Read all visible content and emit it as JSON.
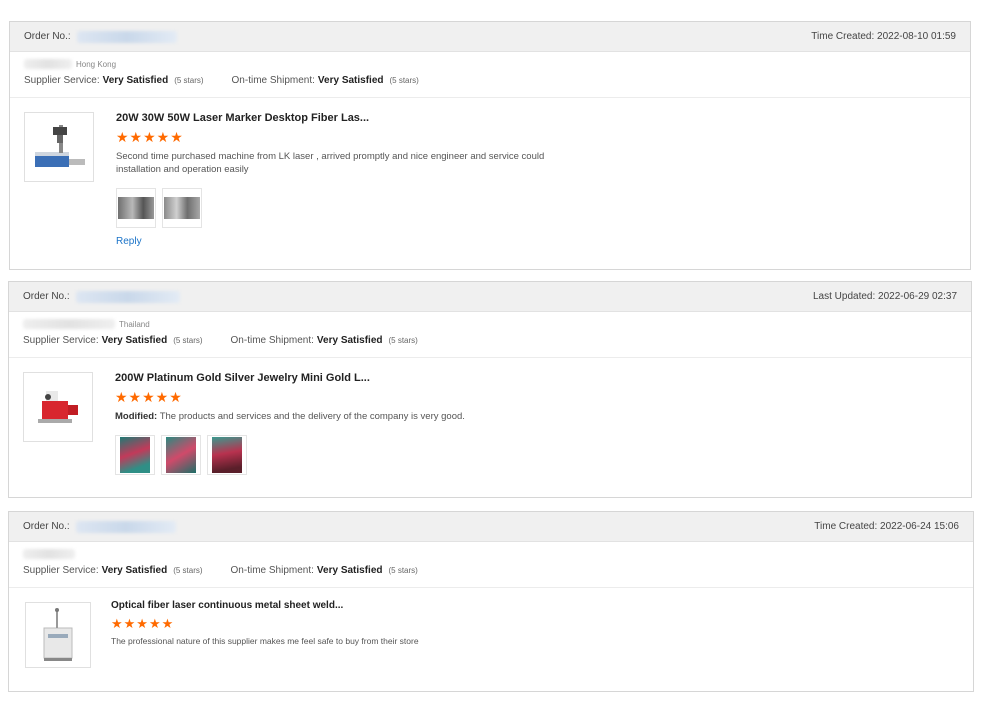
{
  "reviews": [
    {
      "order_label": "Order No.:",
      "time_text": "Time Created: 2022-08-10 01:59",
      "location": "Hong Kong",
      "supplier_service_label": "Supplier Service:",
      "supplier_service_value": "Very Satisfied",
      "supplier_service_stars": "(5 stars)",
      "shipment_label": "On-time Shipment:",
      "shipment_value": "Very Satisfied",
      "shipment_stars": "(5 stars)",
      "product_title": "20W 30W 50W Laser Marker Desktop Fiber Las...",
      "stars": "★★★★★",
      "review_prefix": "",
      "review_text": "Second time purchased machine from LK laser , arrived promptly and nice engineer and service could installation and operation easily",
      "reply_label": "Reply",
      "photo_count": 2
    },
    {
      "order_label": "Order No.:",
      "time_text": "Last Updated: 2022-06-29 02:37",
      "location": "Thailand",
      "supplier_service_label": "Supplier Service:",
      "supplier_service_value": "Very Satisfied",
      "supplier_service_stars": "(5 stars)",
      "shipment_label": "On-time Shipment:",
      "shipment_value": "Very Satisfied",
      "shipment_stars": "(5 stars)",
      "product_title": "200W Platinum Gold Silver Jewelry Mini Gold L...",
      "stars": "★★★★★",
      "review_prefix": "Modified:",
      "review_text": "The products and services and the delivery of the company is very good.",
      "photo_count": 3
    },
    {
      "order_label": "Order No.:",
      "time_text": "Time Created: 2022-06-24 15:06",
      "location": "",
      "supplier_service_label": "Supplier Service:",
      "supplier_service_value": "Very Satisfied",
      "supplier_service_stars": "(5 stars)",
      "shipment_label": "On-time Shipment:",
      "shipment_value": "Very Satisfied",
      "shipment_stars": "(5 stars)",
      "product_title": "Optical fiber laser continuous metal sheet weld...",
      "stars": "★★★★★",
      "review_prefix": "",
      "review_text": "The professional nature of this supplier makes me feel safe to buy from their store",
      "photo_count": 0
    }
  ],
  "colors": {
    "star": "#ff6a00",
    "link": "#1a73c8",
    "header_bg": "#f0f0f0"
  }
}
